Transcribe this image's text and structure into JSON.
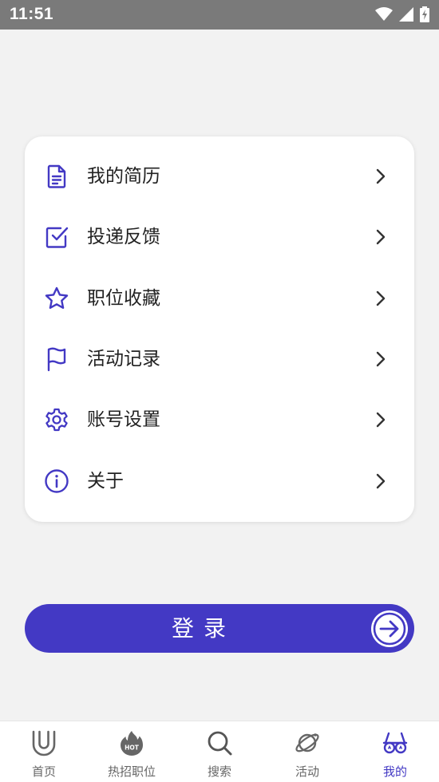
{
  "status_bar": {
    "time": "11:51"
  },
  "menu": {
    "items": [
      {
        "label": "我的简历",
        "icon": "document-icon"
      },
      {
        "label": "投递反馈",
        "icon": "checkbox-icon"
      },
      {
        "label": "职位收藏",
        "icon": "star-icon"
      },
      {
        "label": "活动记录",
        "icon": "flag-icon"
      },
      {
        "label": "账号设置",
        "icon": "gear-icon"
      },
      {
        "label": "关于",
        "icon": "info-icon"
      }
    ]
  },
  "login": {
    "label": "登录"
  },
  "tabbar": {
    "items": [
      {
        "label": "首页",
        "icon": "u-logo-icon"
      },
      {
        "label": "热招职位",
        "icon": "hot-flame-icon"
      },
      {
        "label": "搜索",
        "icon": "search-icon"
      },
      {
        "label": "活动",
        "icon": "planet-icon"
      },
      {
        "label": "我的",
        "icon": "glasses-icon"
      }
    ],
    "active_index": 4
  },
  "colors": {
    "accent": "#4339c4",
    "background": "#f2f2f2",
    "status_bar": "#7a7a7a"
  }
}
